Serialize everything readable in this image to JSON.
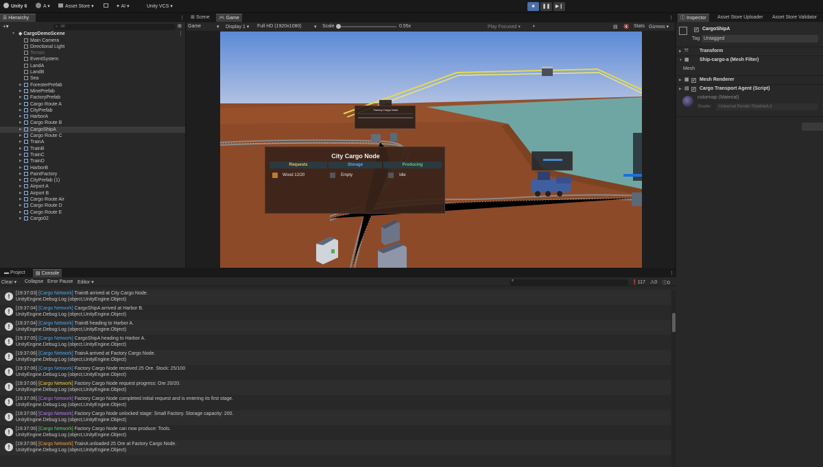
{
  "topbar": {
    "app": "Unity 6",
    "account": "A",
    "asset_store": "Asset Store",
    "ai": "AI",
    "vcs": "Unity VCS"
  },
  "hierarchy": {
    "tab": "Hierarchy",
    "search_placeholder": "All",
    "scene": "CargoDemoScene",
    "items": [
      {
        "label": "Main Camera",
        "prefab": false,
        "dim": false,
        "arrow": false
      },
      {
        "label": "Directional Light",
        "prefab": false,
        "dim": false,
        "arrow": false
      },
      {
        "label": "Terrain",
        "prefab": false,
        "dim": true,
        "arrow": false
      },
      {
        "label": "EventSystem",
        "prefab": false,
        "dim": false,
        "arrow": false
      },
      {
        "label": "LandA",
        "prefab": false,
        "dim": false,
        "arrow": false
      },
      {
        "label": "LandB",
        "prefab": false,
        "dim": false,
        "arrow": false
      },
      {
        "label": "Sea",
        "prefab": false,
        "dim": false,
        "arrow": false
      },
      {
        "label": "ForesterPrefab",
        "prefab": true,
        "dim": false,
        "arrow": true
      },
      {
        "label": "MinePrefab",
        "prefab": true,
        "dim": false,
        "arrow": true
      },
      {
        "label": "FactoryPrefab",
        "prefab": true,
        "dim": false,
        "arrow": true
      },
      {
        "label": "Cargo Route A",
        "prefab": true,
        "dim": false,
        "arrow": true
      },
      {
        "label": "CityPrefab",
        "prefab": true,
        "dim": false,
        "arrow": true
      },
      {
        "label": "HarborA",
        "prefab": true,
        "dim": false,
        "arrow": true
      },
      {
        "label": "Cargo Route B",
        "prefab": true,
        "dim": false,
        "arrow": true
      },
      {
        "label": "CargoShipA",
        "prefab": true,
        "dim": false,
        "arrow": true,
        "selected": true
      },
      {
        "label": "Cargo Route C",
        "prefab": true,
        "dim": false,
        "arrow": true
      },
      {
        "label": "TrainA",
        "prefab": true,
        "dim": false,
        "arrow": true
      },
      {
        "label": "TrainB",
        "prefab": true,
        "dim": false,
        "arrow": true
      },
      {
        "label": "TrainC",
        "prefab": true,
        "dim": false,
        "arrow": true
      },
      {
        "label": "TrainD",
        "prefab": true,
        "dim": false,
        "arrow": true
      },
      {
        "label": "HarborB",
        "prefab": true,
        "dim": false,
        "arrow": true
      },
      {
        "label": "PaintFactory",
        "prefab": true,
        "dim": false,
        "arrow": true
      },
      {
        "label": "CityPrefab (1)",
        "prefab": true,
        "dim": false,
        "arrow": true
      },
      {
        "label": "Airport A",
        "prefab": true,
        "dim": false,
        "arrow": true
      },
      {
        "label": "Airport B",
        "prefab": true,
        "dim": false,
        "arrow": true
      },
      {
        "label": "Cargo Route Air",
        "prefab": true,
        "dim": false,
        "arrow": true
      },
      {
        "label": "Cargo Route D",
        "prefab": true,
        "dim": false,
        "arrow": true
      },
      {
        "label": "Cargo Route E",
        "prefab": true,
        "dim": false,
        "arrow": true
      },
      {
        "label": "Cargo02",
        "prefab": true,
        "dim": false,
        "arrow": true
      }
    ]
  },
  "game": {
    "tabs": [
      "Scene",
      "Game"
    ],
    "mode": "Game",
    "display": "Display 1",
    "resolution": "Full HD (1920x1080)",
    "scale_label": "Scale",
    "scale_value": "0.55x",
    "play_focused": "Play Focused",
    "stats": "Stats",
    "gizmos": "Gizmos",
    "node_panel": {
      "title": "City Cargo Node",
      "requests_header": "Requests",
      "storage_header": "Storage",
      "producing_header": "Producing",
      "request_item": "Wood 12/20",
      "storage_value": "Empty",
      "producing_value": "Idle"
    },
    "factory_panel_title": "Factory Cargo Node"
  },
  "inspector": {
    "tabs": [
      "Inspector",
      "Asset Store Uploader",
      "Asset Store Validator"
    ],
    "object_name": "CargoShipA",
    "tag_label": "Tag",
    "tag_value": "Untagged",
    "components": [
      {
        "label": "Transform",
        "checkbox": false
      },
      {
        "label": "Ship-cargo-a (Mesh Filter)",
        "checkbox": false
      },
      {
        "label": "Mesh Renderer",
        "checkbox": true
      },
      {
        "label": "Cargo Transport Agent (Script)",
        "checkbox": true
      }
    ],
    "mesh_label": "Mesh",
    "material_name": "colormap (Material)",
    "shader_label": "Shader",
    "shader_value": "Universal Render Pipeline/Lit"
  },
  "console": {
    "tabs": [
      "Project",
      "Console"
    ],
    "toolbar": [
      "Clear",
      "Collapse",
      "Error Pause",
      "Editor"
    ],
    "counts": {
      "log": "117",
      "warn": "0",
      "error": "0"
    },
    "entries": [
      {
        "time": "[19:37:03]",
        "tag": "[Cargo Network]",
        "color": "#4fa6e8",
        "msg": "TrainB arrived at City Cargo Node.",
        "sub": "UnityEngine.Debug:Log (object,UnityEngine.Object)"
      },
      {
        "time": "[19:37:04]",
        "tag": "[Cargo Network]",
        "color": "#4fa6e8",
        "msg": "CargoShipA arrived at Harbor B.",
        "sub": "UnityEngine.Debug:Log (object,UnityEngine.Object)"
      },
      {
        "time": "[19:37:04]",
        "tag": "[Cargo Network]",
        "color": "#4fa6e8",
        "msg": "TrainB heading to Harbor A.",
        "sub": "UnityEngine.Debug:Log (object,UnityEngine.Object)"
      },
      {
        "time": "[19:37:05]",
        "tag": "[Cargo Network]",
        "color": "#4fa6e8",
        "msg": "CargoShipA heading to Harbor A.",
        "sub": "UnityEngine.Debug:Log (object,UnityEngine.Object)"
      },
      {
        "time": "[19:37:06]",
        "tag": "[Cargo Network]",
        "color": "#4fa6e8",
        "msg": "TrainA arrived at Factory Cargo Node.",
        "sub": "UnityEngine.Debug:Log (object,UnityEngine.Object)"
      },
      {
        "time": "[19:37:06]",
        "tag": "[Cargo Network]",
        "color": "#4fa6e8",
        "msg": "Factory Cargo Node received 25 Ore. Stock: 25/100",
        "sub": "UnityEngine.Debug:Log (object,UnityEngine.Object)"
      },
      {
        "time": "[19:37:06]",
        "tag": "[Cargo Network]",
        "color": "#e8c64f",
        "msg": "Factory Cargo Node request progress: Ore 20/20.",
        "sub": "UnityEngine.Debug:Log (object,UnityEngine.Object)"
      },
      {
        "time": "[19:37:06]",
        "tag": "[Cargo Network]",
        "color": "#b07ee8",
        "msg": "Factory Cargo Node completed initial request and is entering its first stage.",
        "sub": "UnityEngine.Debug:Log (object,UnityEngine.Object)"
      },
      {
        "time": "[19:37:06]",
        "tag": "[Cargo Network]",
        "color": "#b07ee8",
        "msg": "Factory Cargo Node unlocked stage: Small Factory. Storage capacity: 200.",
        "sub": "UnityEngine.Debug:Log (object,UnityEngine.Object)"
      },
      {
        "time": "[19:37:06]",
        "tag": "[Cargo Network]",
        "color": "#5fd06a",
        "msg": "Factory Cargo Node can now produce: Tools.",
        "sub": "UnityEngine.Debug:Log (object,UnityEngine.Object)"
      },
      {
        "time": "[19:37:06]",
        "tag": "[Cargo Network]",
        "color": "#e8a04f",
        "msg": "TrainA unloaded 25 Ore at Factory Cargo Node.",
        "sub": "UnityEngine.Debug:Log (object,UnityEngine.Object)"
      }
    ]
  }
}
